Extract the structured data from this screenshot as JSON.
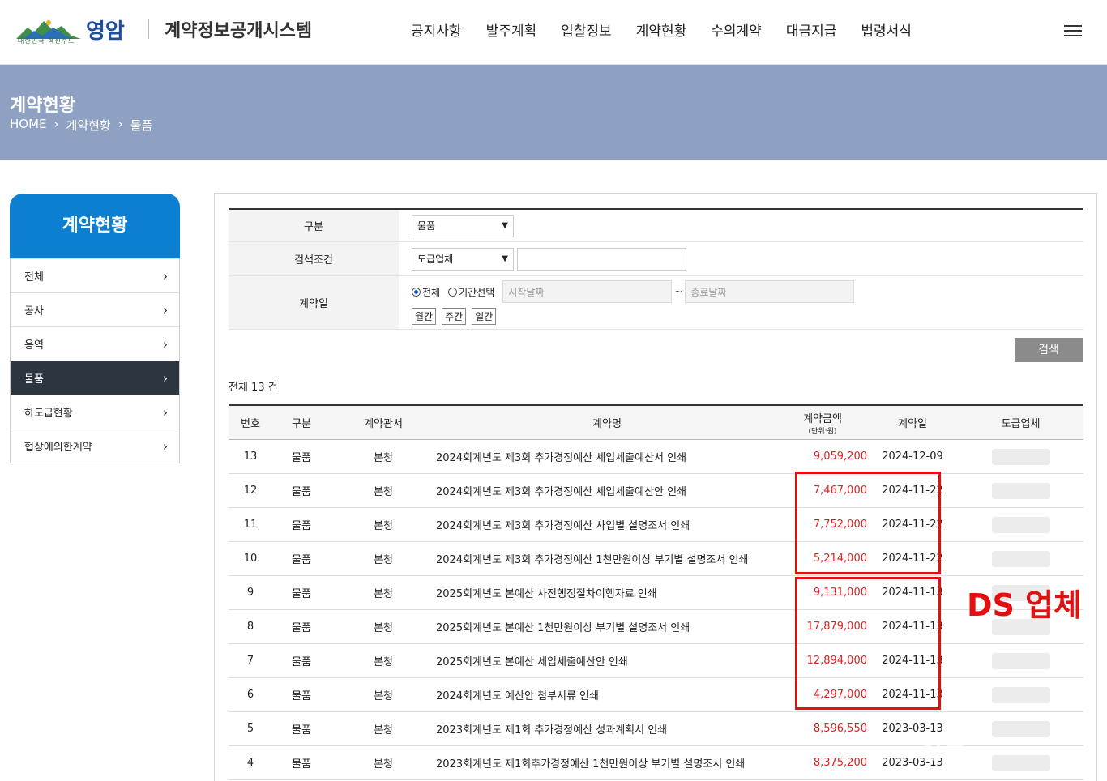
{
  "header": {
    "logo_text": "영암",
    "logo_sub": "대한민국 혁신수도",
    "site_title": "계약정보공개시스템",
    "nav": [
      "공지사항",
      "발주계획",
      "입찰정보",
      "계약현황",
      "수의계약",
      "대금지급",
      "법령서식"
    ]
  },
  "banner": {
    "title": "계약현황",
    "breadcrumb": [
      "HOME",
      "계약현황",
      "물품"
    ]
  },
  "sidebar": {
    "title": "계약현황",
    "items": [
      {
        "label": "전체",
        "active": false
      },
      {
        "label": "공사",
        "active": false
      },
      {
        "label": "용역",
        "active": false
      },
      {
        "label": "물품",
        "active": true
      },
      {
        "label": "하도급현황",
        "active": false
      },
      {
        "label": "협상에의한계약",
        "active": false
      }
    ]
  },
  "search": {
    "type_label": "구분",
    "type_value": "물품",
    "cond_label": "검색조건",
    "cond_value": "도급업체",
    "date_label": "계약일",
    "radio_all": "전체",
    "radio_period": "기간선택",
    "start_placeholder": "시작날짜",
    "end_placeholder": "종료날짜",
    "tilde": "~",
    "periods": [
      "월간",
      "주간",
      "일간"
    ],
    "button": "검색"
  },
  "total_text": "전체 13 건",
  "table": {
    "headers": {
      "no": "번호",
      "type": "구분",
      "office": "계약관서",
      "name": "계약명",
      "amount": "계약금액",
      "amount_unit": "(단위:원)",
      "date": "계약일",
      "vendor": "도급업체"
    },
    "rows": [
      {
        "no": "13",
        "type": "물품",
        "office": "본청",
        "name": "2024회계년도 제3회 추가경정예산 세입세출예산서 인쇄",
        "amount": "9,059,200",
        "date": "2024-12-09"
      },
      {
        "no": "12",
        "type": "물품",
        "office": "본청",
        "name": "2024회계년도 제3회 추가경정예산 세입세출예산안 인쇄",
        "amount": "7,467,000",
        "date": "2024-11-22"
      },
      {
        "no": "11",
        "type": "물품",
        "office": "본청",
        "name": "2024회계년도 제3회 추가경정예산 사업별 설명조서 인쇄",
        "amount": "7,752,000",
        "date": "2024-11-22"
      },
      {
        "no": "10",
        "type": "물품",
        "office": "본청",
        "name": "2024회계년도 제3회 추가경정예산 1천만원이상 부기별 설명조서 인쇄",
        "amount": "5,214,000",
        "date": "2024-11-22"
      },
      {
        "no": "9",
        "type": "물품",
        "office": "본청",
        "name": "2025회계년도 본예산 사전행정절차이행자료 인쇄",
        "amount": "9,131,000",
        "date": "2024-11-13"
      },
      {
        "no": "8",
        "type": "물품",
        "office": "본청",
        "name": "2025회계년도 본예산 1천만원이상 부기별 설명조서 인쇄",
        "amount": "17,879,000",
        "date": "2024-11-13"
      },
      {
        "no": "7",
        "type": "물품",
        "office": "본청",
        "name": "2025회계년도 본예산 세입세출예산안 인쇄",
        "amount": "12,894,000",
        "date": "2024-11-13"
      },
      {
        "no": "6",
        "type": "물품",
        "office": "본청",
        "name": "2024회계년도 예산안 첨부서류 인쇄",
        "amount": "4,297,000",
        "date": "2024-11-13"
      },
      {
        "no": "5",
        "type": "물품",
        "office": "본청",
        "name": "2023회계년도 제1회 추가경정예산 성과계획서 인쇄",
        "amount": "8,596,550",
        "date": "2023-03-13"
      },
      {
        "no": "4",
        "type": "물품",
        "office": "본청",
        "name": "2023회계년도 제1회추가경정예산 1천만원이상 부기별 설명조서 인쇄",
        "amount": "8,375,200",
        "date": "2023-03-13"
      }
    ]
  },
  "annotation": "DS 업체",
  "watermark": "신문",
  "colors": {
    "banner": "#8ea1c2",
    "sidebar_head": "#0d7fd0",
    "sidebar_active": "#2b3641",
    "amount": "#e02020",
    "annotation": "#e31010"
  }
}
